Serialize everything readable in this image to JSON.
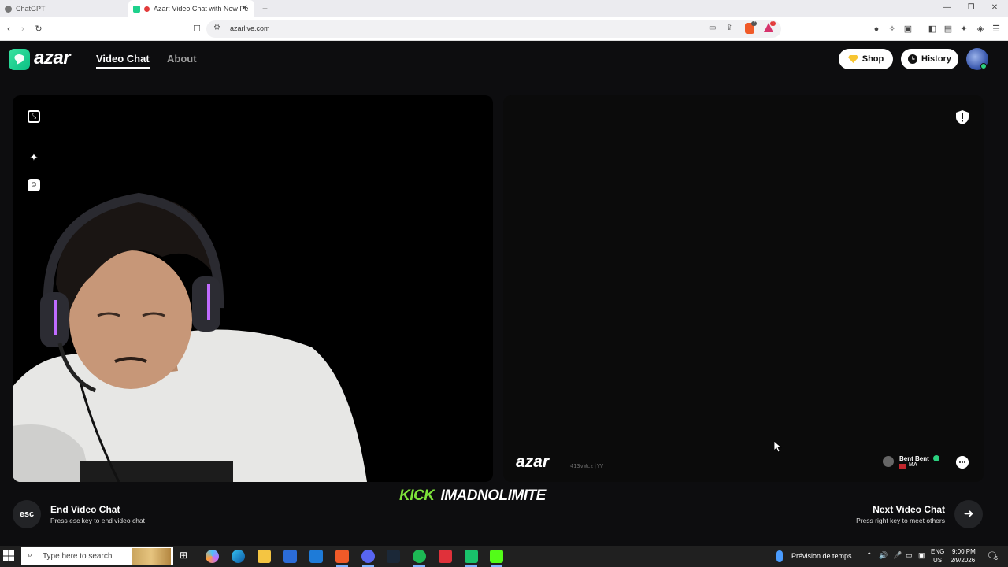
{
  "browser": {
    "tabs": [
      {
        "title": "ChatGPT",
        "active": false
      },
      {
        "title": "Azar: Video Chat with New Pe",
        "active": true
      }
    ],
    "new_tab": "+",
    "url": "azarlive.com",
    "window_controls": [
      "minimize-icon",
      "restore-icon",
      "close-icon"
    ],
    "shields_badge": "7",
    "rewards_badge": "1"
  },
  "header": {
    "logo_text": "azar",
    "nav": [
      {
        "label": "Video Chat",
        "active": true
      },
      {
        "label": "About",
        "active": false
      }
    ],
    "shop_label": "Shop",
    "history_label": "History"
  },
  "local_video": {
    "controls": [
      "expand-icon",
      "magic-wand-icon",
      "face-filter-icon"
    ]
  },
  "remote_video": {
    "watermark_logo": "azar",
    "watermark_id": "413vWczjYV",
    "peer_name": "Bent Bent",
    "peer_country": "MA",
    "controls": [
      "report-icon",
      "chat-icon"
    ]
  },
  "controls": {
    "esc_label": "esc",
    "end_title": "End Video Chat",
    "end_subtitle": "Press esc key to end video chat",
    "next_title": "Next Video Chat",
    "next_subtitle": "Press right key to meet others"
  },
  "caption": {
    "word1": "KICK",
    "word2": "IMADNOLIMITE"
  },
  "taskbar": {
    "search_placeholder": "Type here to search",
    "weather_label": "Prévision de temps",
    "language": "ENG",
    "region": "US",
    "time": "9:00 PM",
    "date": "2/9/2026",
    "notification_count": "6"
  },
  "colors": {
    "brand_green": "#1ed18c",
    "caption_green": "#7ee23a",
    "page_bg": "#0d0d0f"
  }
}
